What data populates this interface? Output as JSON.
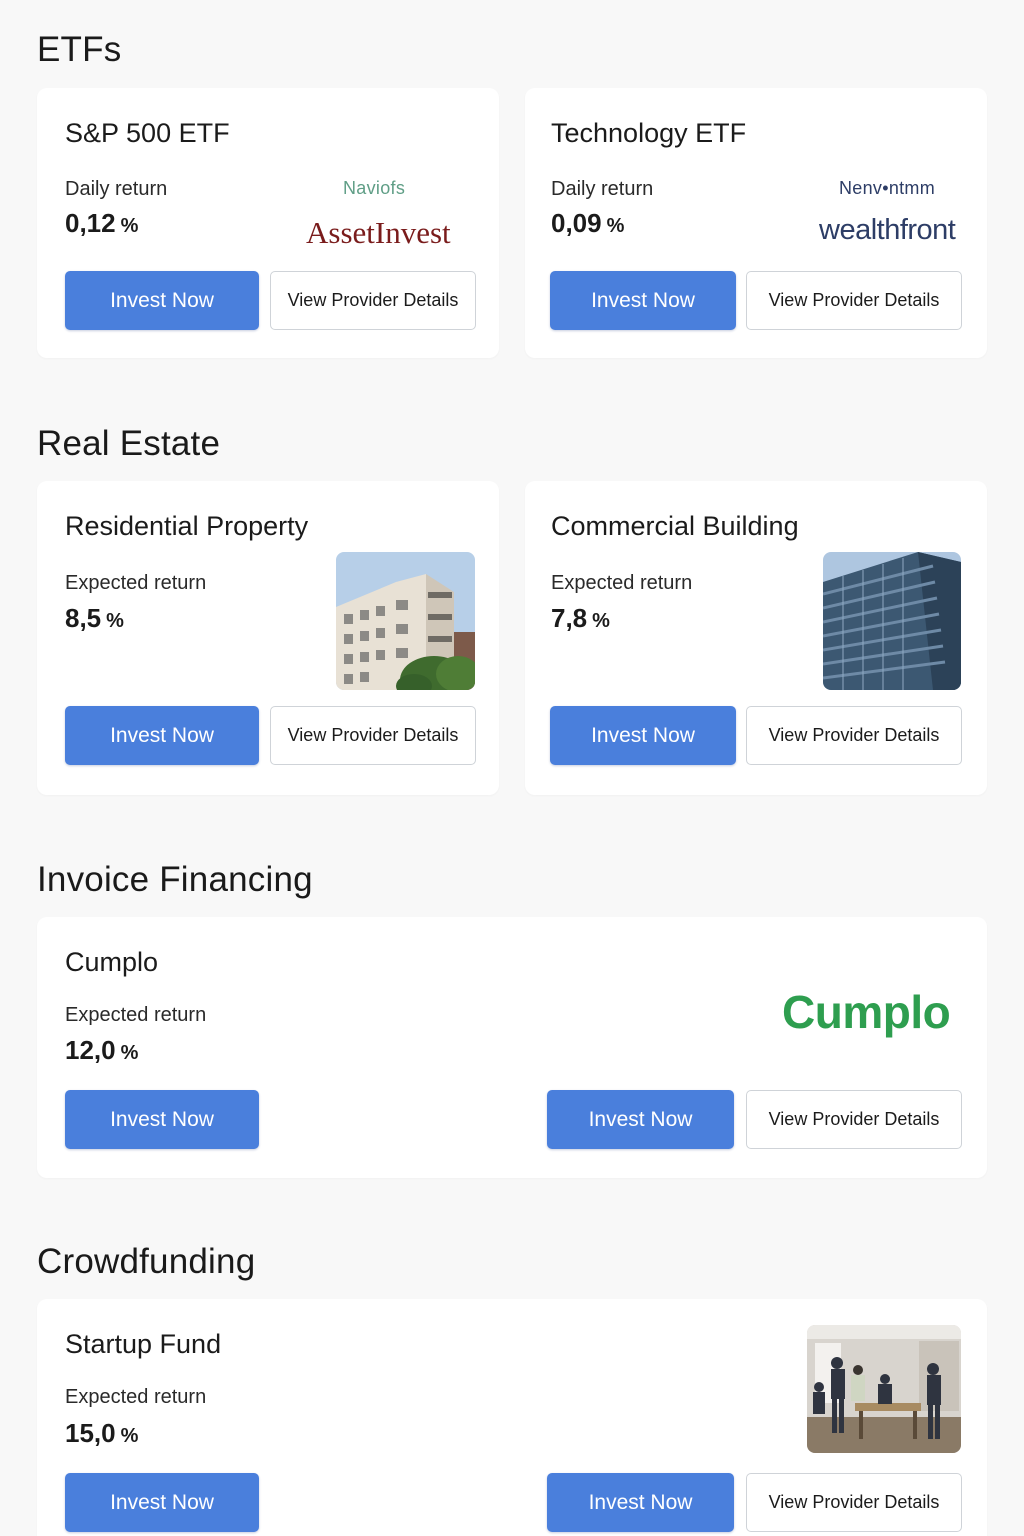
{
  "sections": {
    "etfs": {
      "title": "ETFs",
      "cards": [
        {
          "title": "S&P 500 ETF",
          "metric_label": "Daily return",
          "metric_value": "0,12",
          "unit": "%",
          "provider_tagline": "Naviofs",
          "provider_logo": "AssetInvest",
          "invest_label": "Invest Now",
          "details_label": "View Provider Details"
        },
        {
          "title": "Technology ETF",
          "metric_label": "Daily return",
          "metric_value": "0,09",
          "unit": "%",
          "provider_tagline": "Nenv•ntmm",
          "provider_logo": "wealthfront",
          "invest_label": "Invest Now",
          "details_label": "View Provider Details"
        }
      ]
    },
    "real_estate": {
      "title": "Real Estate",
      "cards": [
        {
          "title": "Residential Property",
          "metric_label": "Expected return",
          "metric_value": "8,5",
          "unit": "%",
          "image": "apartment-building-photo",
          "invest_label": "Invest Now",
          "details_label": "View Provider Details"
        },
        {
          "title": "Commercial Building",
          "metric_label": "Expected return",
          "metric_value": "7,8",
          "unit": "%",
          "image": "glass-office-building-photo",
          "invest_label": "Invest Now",
          "details_label": "View Provider Details"
        }
      ]
    },
    "invoice_financing": {
      "title": "Invoice Financing",
      "card": {
        "title": "Cumplo",
        "metric_label": "Expected return",
        "metric_value": "12,0",
        "unit": "%",
        "provider_logo": "Cumplo",
        "invest_label": "Invest Now",
        "invest_label_2": "Invest Now",
        "details_label": "View Provider Details"
      }
    },
    "crowdfunding": {
      "title": "Crowdfunding",
      "card": {
        "title": "Startup Fund",
        "metric_label": "Expected return",
        "metric_value": "15,0",
        "unit": "%",
        "image": "startup-office-photo",
        "invest_label": "Invest Now",
        "invest_label_2": "Invest Now",
        "details_label": "View Provider Details"
      }
    }
  },
  "colors": {
    "primary_button": "#4a7fdc",
    "assetinvest_logo": "#7a1c1c",
    "wealthfront_logo": "#2d3d66",
    "cumplo_logo": "#2e9e4f",
    "naviofs_tagline": "#5f9e86"
  }
}
